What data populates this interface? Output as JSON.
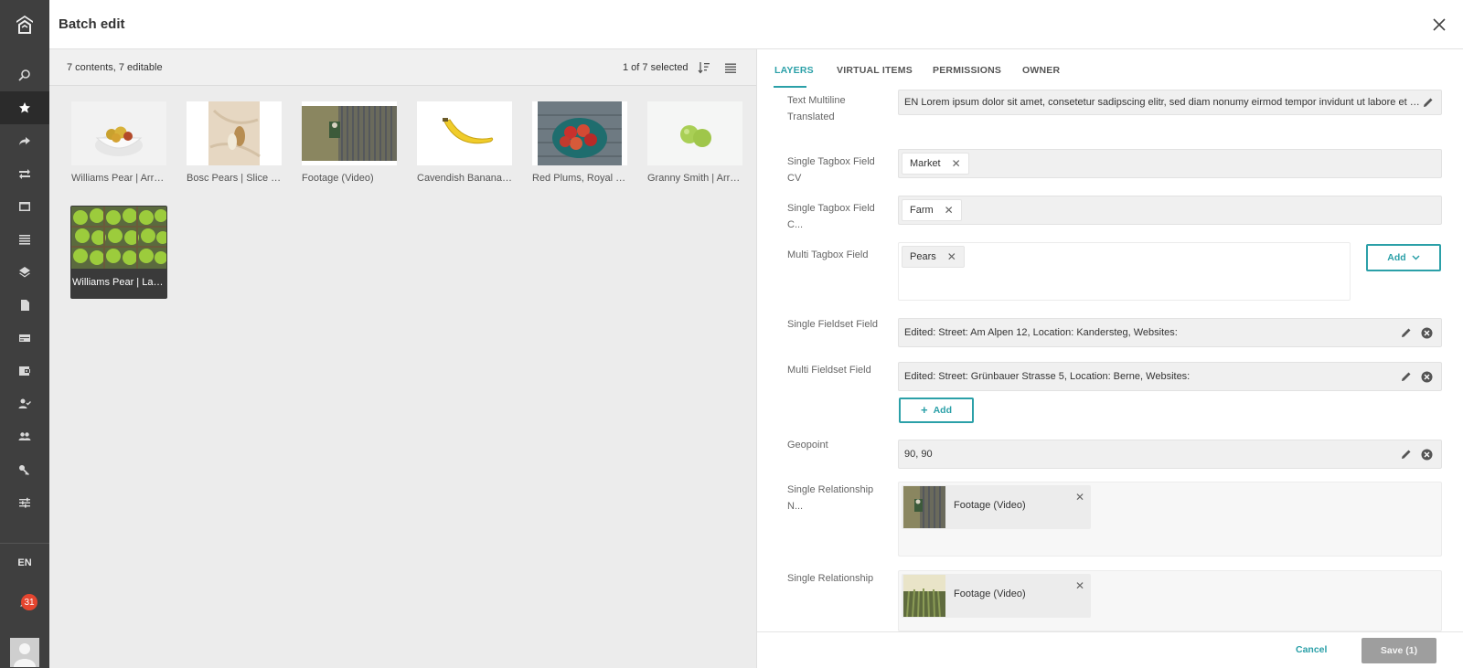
{
  "header": {
    "title": "Batch edit"
  },
  "rail": {
    "language": "EN",
    "notification_count": "31",
    "items": [
      {
        "icon": "search-icon"
      },
      {
        "icon": "star-icon"
      },
      {
        "icon": "share-icon"
      },
      {
        "icon": "transfer-icon"
      },
      {
        "icon": "window-icon"
      },
      {
        "icon": "list-icon"
      },
      {
        "icon": "layers-icon"
      },
      {
        "icon": "document-icon"
      },
      {
        "icon": "card-icon"
      },
      {
        "icon": "wallet-icon"
      },
      {
        "icon": "user-check-icon"
      },
      {
        "icon": "people-icon"
      },
      {
        "icon": "key-icon"
      },
      {
        "icon": "sliders-icon"
      }
    ]
  },
  "left": {
    "count_text": "7 contents, 7 editable",
    "selection_text": "1 of  7 selected",
    "tiles": [
      {
        "label": "Williams Pear | Arrangement"
      },
      {
        "label": "Bosc Pears | Slice still"
      },
      {
        "label": "Footage (Video)"
      },
      {
        "label": "Cavendish Bananas | Single"
      },
      {
        "label": "Red Plums, Royal Gala"
      },
      {
        "label": "Granny Smith | Arrangement"
      },
      {
        "label": "Williams Pear | Layout"
      }
    ]
  },
  "right": {
    "tabs": [
      "LAYERS",
      "VIRTUAL ITEMS",
      "PERMISSIONS",
      "OWNER"
    ],
    "fields": {
      "text_multiline": {
        "label": "Text Multiline Translated",
        "value": "EN Lorem ipsum dolor sit amet, consetetur sadipscing elitr, sed diam nonumy eirmod tempor invidunt ut labore et dolore magna"
      },
      "single_tagbox_cv": {
        "label": "Single Tagbox Field CV",
        "chip": "Market"
      },
      "single_tagbox_c": {
        "label": "Single Tagbox Field C...",
        "chip": "Farm"
      },
      "multi_tagbox": {
        "label": "Multi Tagbox Field",
        "chip": "Pears",
        "add_label": "Add"
      },
      "single_fieldset": {
        "label": "Single Fieldset Field",
        "value": "Edited:  Street: Am Alpen 12, Location: Kandersteg, Websites:"
      },
      "multi_fieldset": {
        "label": "Multi Fieldset Field",
        "value": "Edited:  Street: Grünbauer Strasse 5, Location: Berne, Websites:",
        "add_label": "Add"
      },
      "geopoint": {
        "label": "Geopoint",
        "value": "90, 90"
      },
      "single_relationship_n": {
        "label": "Single Relationship N...",
        "item": "Footage (Video)"
      },
      "single_relationship": {
        "label": "Single Relationship",
        "item": "Footage (Video)"
      }
    },
    "footer": {
      "cancel": "Cancel",
      "save": "Save (1)"
    }
  },
  "colors": {
    "accent": "#2ba0a8",
    "rail": "#3f3f3f",
    "badge": "#e5452f"
  }
}
